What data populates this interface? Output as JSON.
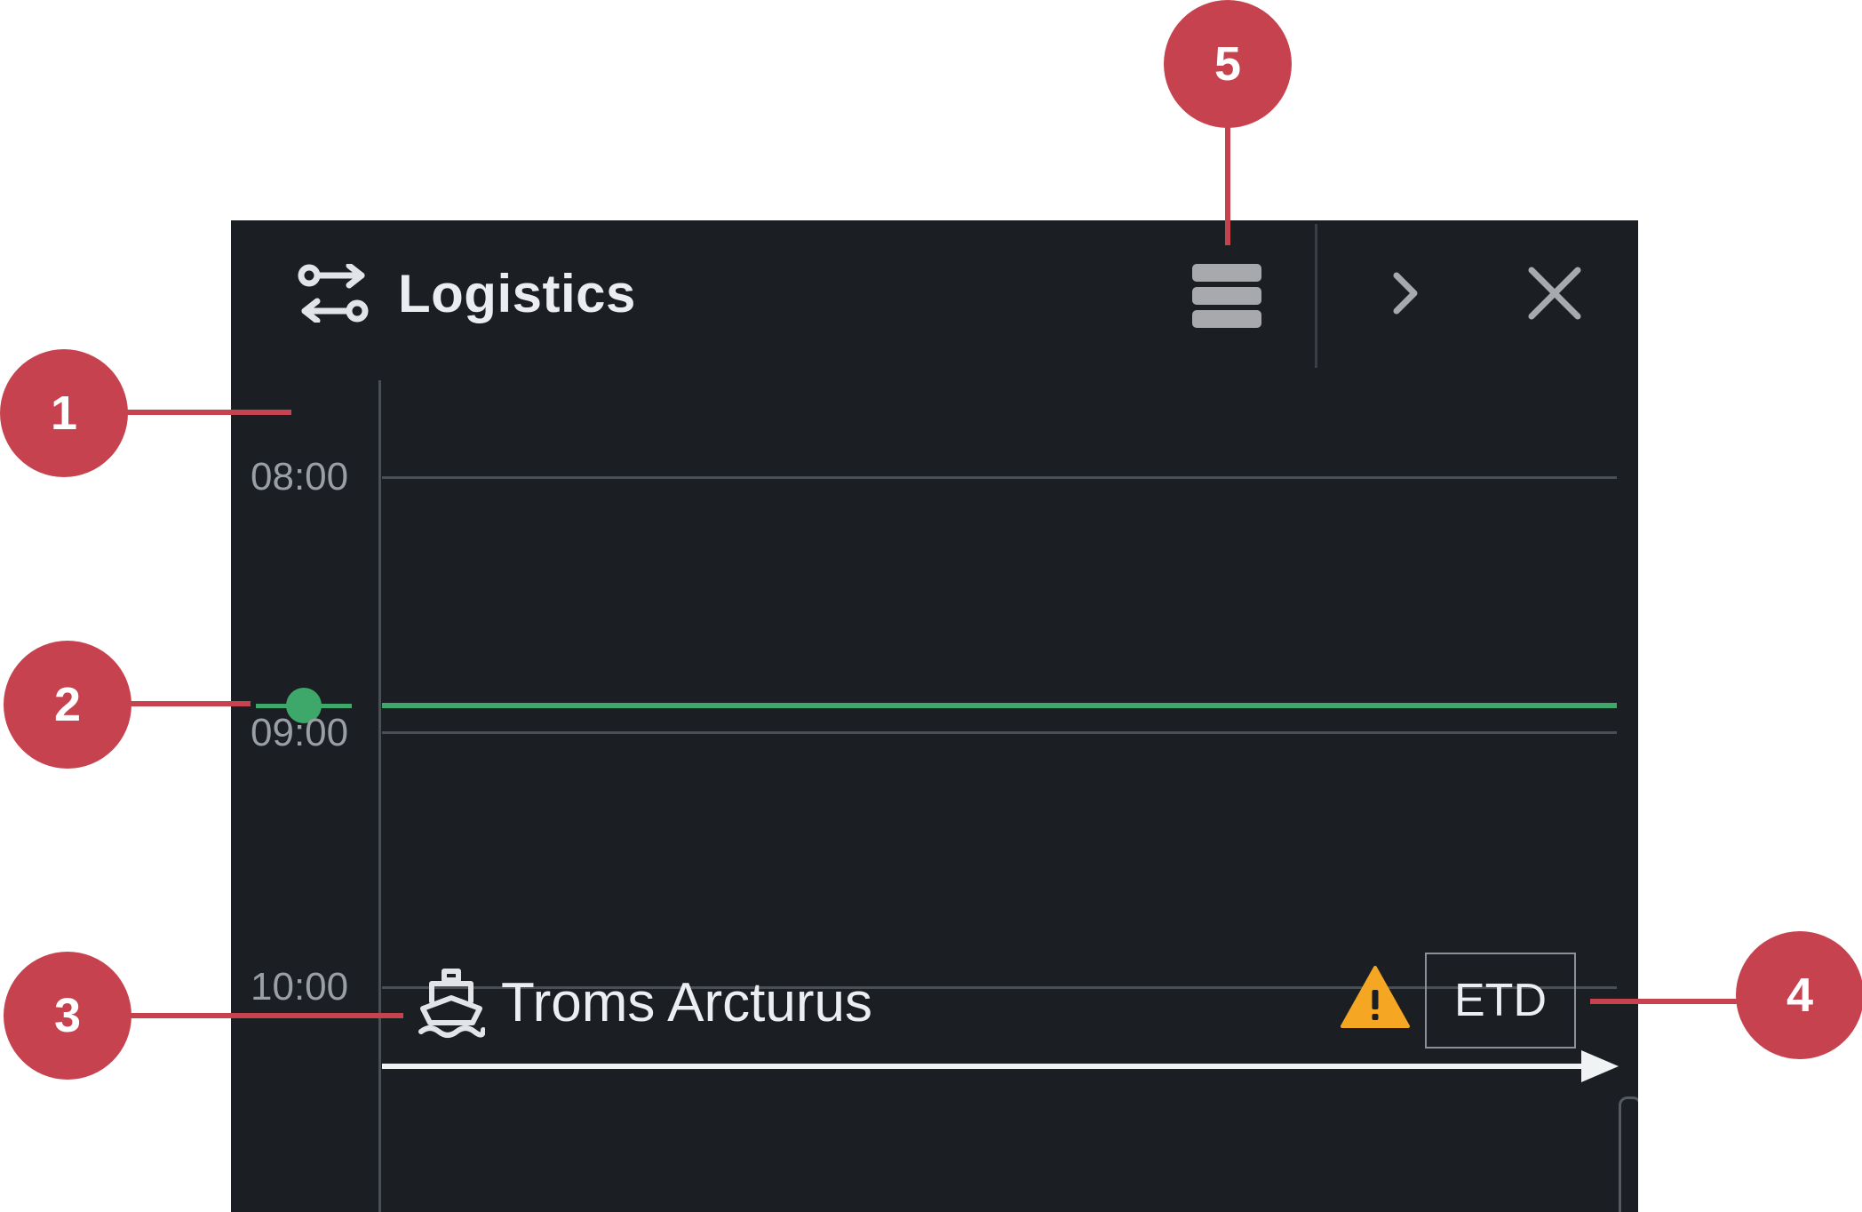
{
  "app": {
    "title": "Logistics",
    "icon": "swap-route-icon"
  },
  "toolbar": {
    "menu_icon": "stacked-menu-icon",
    "expand_icon": "chevron-right-icon",
    "close_icon": "close-icon"
  },
  "timeline": {
    "time_labels": [
      "08:00",
      "09:00",
      "10:00"
    ],
    "current_time_indicator_color": "#3ea86a"
  },
  "vessel": {
    "name": "Troms Arcturus",
    "icon": "ship-icon",
    "warning_icon": "warning-triangle-icon",
    "warning_color": "#f5a623",
    "badge": "ETD"
  },
  "annotations": [
    "1",
    "2",
    "3",
    "4",
    "5"
  ],
  "colors": {
    "panel_bg": "#1b1e23",
    "callout": "#c6424e"
  }
}
